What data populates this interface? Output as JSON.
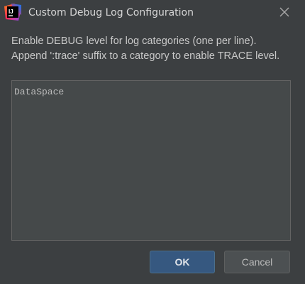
{
  "window": {
    "title": "Custom Debug Log Configuration",
    "app_icon": "intellij-idea-icon",
    "close_icon": "close-icon"
  },
  "description": {
    "line1": "Enable DEBUG level for log categories (one per line).",
    "line2": "Append ':trace' suffix to a category to enable TRACE level."
  },
  "editor": {
    "value": "DataSpace"
  },
  "buttons": {
    "ok_label": "OK",
    "cancel_label": "Cancel"
  },
  "colors": {
    "background": "#3c3f41",
    "primary_button": "#365880",
    "secondary_button": "#4c5052",
    "editor_background": "#45494a"
  }
}
